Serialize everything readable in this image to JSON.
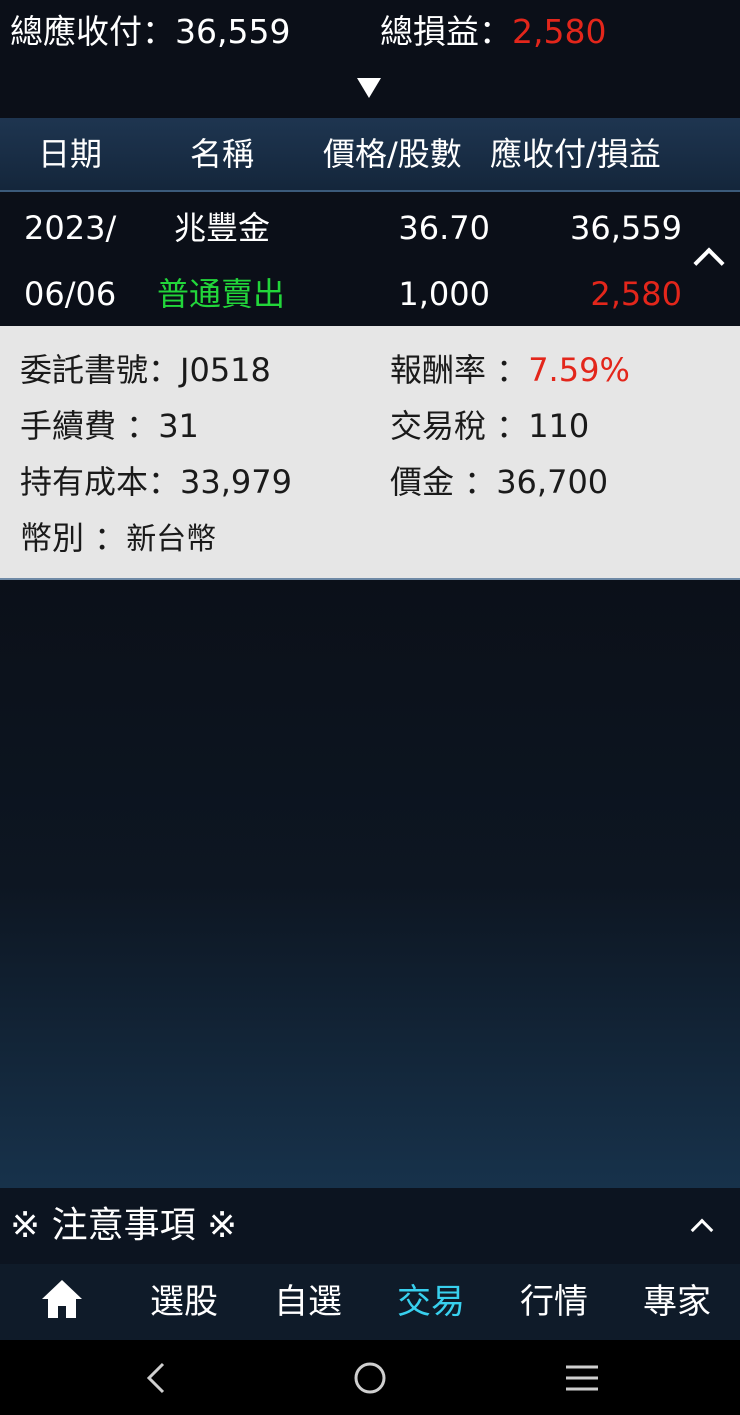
{
  "summary": {
    "total_receivable_label": "總應收付：",
    "total_receivable_value": "36,559",
    "total_pnl_label": "總損益：",
    "total_pnl_value": "2,580"
  },
  "table_header": {
    "date": "日期",
    "name": "名稱",
    "price_shares": "價格/股數",
    "receivable_pnl": "應收付/損益"
  },
  "row": {
    "date_line1": "2023/",
    "date_line2": "06/06",
    "name": "兆豐金",
    "type": "普通賣出",
    "price": "36.70",
    "shares": "1,000",
    "receivable": "36,559",
    "pnl": "2,580"
  },
  "details": {
    "order_no_label": "委託書號：",
    "order_no": "J0518",
    "return_label": "報酬率  ：",
    "return_value": "7.59%",
    "fee_label": "手續費  ：",
    "fee_value": "31",
    "tax_label": "交易稅  ：",
    "tax_value": "110",
    "cost_label": "持有成本：",
    "cost_value": "33,979",
    "amount_label": "價金  ：",
    "amount_value": "36,700",
    "currency_label": "幣別  ：",
    "currency_value": "新台幣"
  },
  "notice": {
    "text": "※ 注意事項 ※"
  },
  "tabs": [
    {
      "label": "選股"
    },
    {
      "label": "自選"
    },
    {
      "label": "交易"
    },
    {
      "label": "行情"
    },
    {
      "label": "專家"
    }
  ],
  "colors": {
    "positive": "#e3261b",
    "sell": "#22d63a",
    "active_tab": "#38d0ee"
  },
  "icons": {
    "home": "home-icon",
    "expand": "chevron-down-icon",
    "collapse": "chevron-up-icon",
    "back": "back-icon",
    "home_nav": "circle-home-icon",
    "menu": "menu-icon"
  }
}
